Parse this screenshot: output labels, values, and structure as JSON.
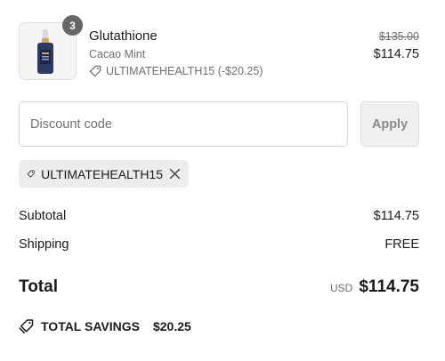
{
  "product": {
    "name": "Glutathione",
    "variant": "Cacao Mint",
    "discount_label": "ULTIMATEHEALTH15 (-$20.25)",
    "compare_price": "$135.00",
    "price": "$114.75",
    "quantity": "3",
    "image_icon": "dropper-bottle-icon"
  },
  "discount": {
    "placeholder": "Discount code",
    "value": "",
    "apply_label": "Apply"
  },
  "applied_code": {
    "code": "ULTIMATEHEALTH15",
    "icon": "tag-icon",
    "remove_icon": "close-icon"
  },
  "summary": {
    "subtotal_label": "Subtotal",
    "subtotal_value": "$114.75",
    "shipping_label": "Shipping",
    "shipping_value": "FREE",
    "total_label": "Total",
    "currency": "USD",
    "total_value": "$114.75",
    "savings_label": "TOTAL SAVINGS",
    "savings_value": "$20.25"
  },
  "colors": {
    "badge": "#666666",
    "muted_text": "#707070",
    "chip_bg": "#ececec",
    "button_bg": "#f0f0f0"
  }
}
